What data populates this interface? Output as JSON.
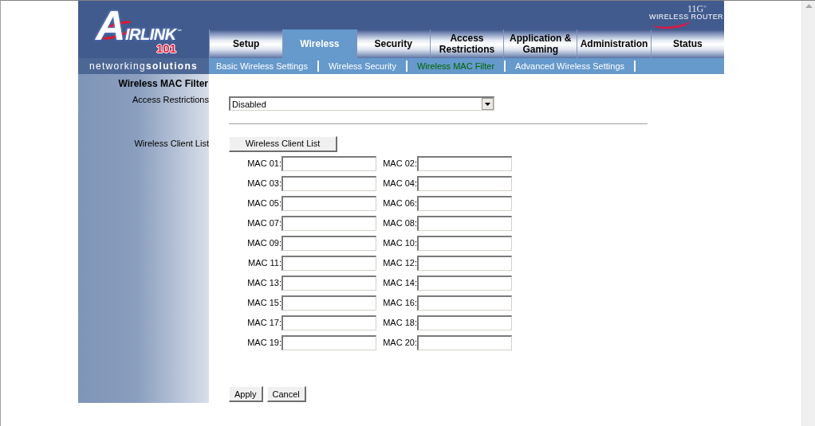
{
  "header": {
    "logo": {
      "brand": "AIRLINK",
      "trademark": "™",
      "model": "101",
      "tagline": "networking**solutions**"
    },
    "product_logo": {
      "model": "11G$^{®}$",
      "name": "WIRELESS ROUTER"
    }
  },
  "tabs": [
    {
      "label": "Setup",
      "selected": false
    },
    {
      "label": "Wireless",
      "selected": true
    },
    {
      "label": "Security",
      "selected": false
    },
    {
      "label": "Access Restrictions",
      "selected": false
    },
    {
      "label": "Application & Gaming",
      "selected": false
    },
    {
      "label": "Administration",
      "selected": false
    },
    {
      "label": "Status",
      "selected": false
    }
  ],
  "subtabs": [
    {
      "label": "Basic Wireless Settings",
      "selected": false
    },
    {
      "label": "Wireless Security",
      "selected": false
    },
    {
      "label": "Wireless MAC Filter",
      "selected": true
    },
    {
      "label": "Advanced Wireless Settings",
      "selected": false
    }
  ],
  "sidebar": {
    "title": "Wireless MAC Filter",
    "labels": [
      "Access Restrictions",
      "Wireless Client List"
    ]
  },
  "form": {
    "access_restrictions": {
      "value": "Disabled"
    },
    "client_list_button": "Wireless Client List",
    "mac_fields": [
      "MAC 01:",
      "MAC 02:",
      "MAC 03:",
      "MAC 04:",
      "MAC 05:",
      "MAC 06:",
      "MAC 07:",
      "MAC 08:",
      "MAC 09:",
      "MAC 10:",
      "MAC 11:",
      "MAC 12:",
      "MAC 13:",
      "MAC 14:",
      "MAC 15:",
      "MAC 16:",
      "MAC 17:",
      "MAC 18:",
      "MAC 19:",
      "MAC 20:"
    ]
  },
  "buttons": [
    "Apply",
    "Cancel"
  ]
}
